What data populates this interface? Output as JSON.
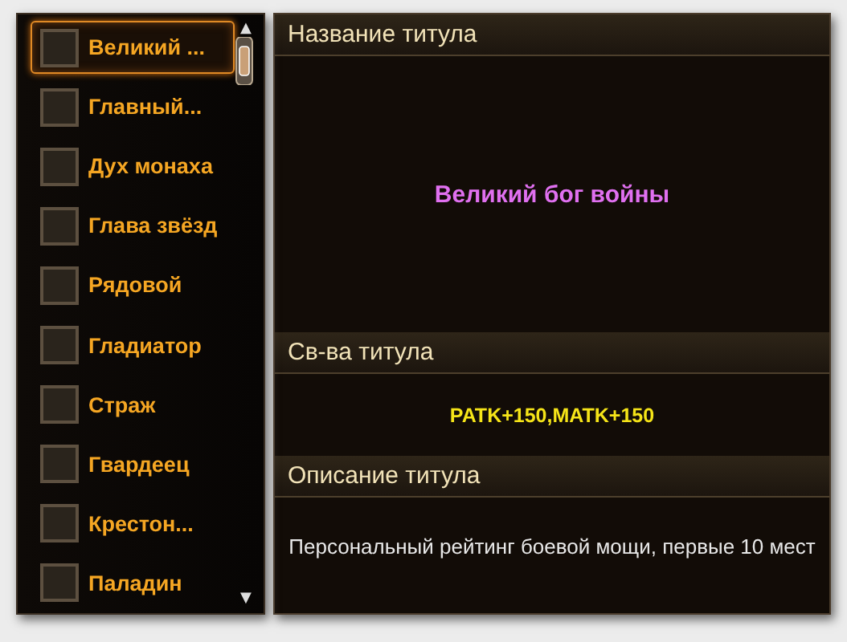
{
  "titles": [
    {
      "label": "Великий ...",
      "selected": true,
      "checked": false
    },
    {
      "label": "Главный...",
      "selected": false,
      "checked": false
    },
    {
      "label": "Дух монаха",
      "selected": false,
      "checked": false
    },
    {
      "label": "Глава звёзд",
      "selected": false,
      "checked": false
    },
    {
      "label": "Рядовой",
      "selected": false,
      "checked": false
    },
    {
      "label": "Гладиатор",
      "selected": false,
      "checked": false
    },
    {
      "label": "Страж",
      "selected": false,
      "checked": false
    },
    {
      "label": "Гвардеец",
      "selected": false,
      "checked": false
    },
    {
      "label": "Крестон...",
      "selected": false,
      "checked": false
    },
    {
      "label": "Паладин",
      "selected": false,
      "checked": false
    }
  ],
  "scroll": {
    "up": "▲",
    "down": "▼"
  },
  "sections": [
    {
      "heading": "Название титула",
      "kind": "name",
      "text": "Великий бог войны"
    },
    {
      "heading": "Св-ва титула",
      "kind": "stats",
      "text": "PATK+150,MATK+150"
    },
    {
      "heading": "Описание титула",
      "kind": "description",
      "text": "Персональный рейтинг боевой мощи, первые 10 мест"
    }
  ]
}
